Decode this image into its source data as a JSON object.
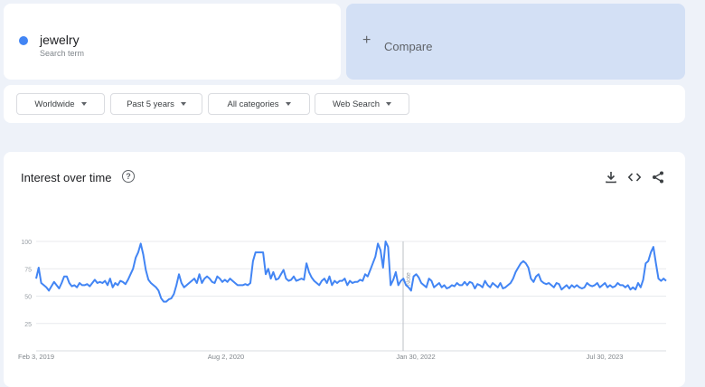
{
  "search": {
    "term": "jewelry",
    "term_subtitle": "Search term",
    "term_color": "#4285f4",
    "compare_label": "Compare",
    "compare_icon": "plus-icon"
  },
  "filters": [
    {
      "label": "Worldwide"
    },
    {
      "label": "Past 5 years"
    },
    {
      "label": "All categories"
    },
    {
      "label": "Web Search"
    }
  ],
  "chart_panel": {
    "title": "Interest over time",
    "help_icon": "help-icon",
    "tools": [
      "download-icon",
      "embed-icon",
      "share-icon"
    ]
  },
  "chart_data": {
    "type": "line",
    "ylim": [
      0,
      100
    ],
    "yticks": [
      25,
      50,
      75,
      100
    ],
    "grid": true,
    "xlabels": [
      "Feb 3, 2019",
      "Aug 2, 2020",
      "Jan 30, 2022",
      "Jul 30, 2023"
    ],
    "annotation": "Note",
    "line_color": "#4285f4",
    "series": [
      {
        "values": [
          66,
          76,
          62,
          60,
          58,
          55,
          59,
          63,
          60,
          57,
          62,
          68,
          68,
          62,
          59,
          60,
          58,
          62,
          60,
          60,
          61,
          59,
          62,
          65,
          62,
          63,
          62,
          64,
          60,
          66,
          58,
          62,
          60,
          64,
          63,
          61,
          65,
          70,
          75,
          85,
          90,
          98,
          88,
          74,
          65,
          62,
          60,
          58,
          55,
          48,
          45,
          45,
          47,
          48,
          52,
          60,
          70,
          62,
          58,
          60,
          62,
          64,
          66,
          62,
          70,
          62,
          66,
          68,
          66,
          63,
          62,
          68,
          66,
          63,
          65,
          63,
          66,
          64,
          62,
          60,
          60,
          60,
          61,
          60,
          62,
          82,
          90,
          90,
          90,
          90,
          70,
          75,
          66,
          72,
          65,
          66,
          70,
          74,
          66,
          64,
          65,
          68,
          64,
          65,
          66,
          65,
          80,
          72,
          67,
          64,
          62,
          60,
          64,
          66,
          62,
          68,
          60,
          64,
          62,
          64,
          64,
          66,
          60,
          64,
          62,
          63,
          63,
          65,
          64,
          70,
          68,
          74,
          80,
          86,
          98,
          92,
          76,
          100,
          95,
          60,
          65,
          72,
          60,
          64,
          66,
          60,
          58,
          55,
          68,
          70,
          67,
          62,
          60,
          58,
          66,
          64,
          58,
          60,
          62,
          58,
          60,
          57,
          58,
          60,
          59,
          62,
          60,
          60,
          63,
          60,
          63,
          62,
          57,
          61,
          60,
          58,
          64,
          60,
          58,
          62,
          60,
          58,
          62,
          57,
          58,
          60,
          62,
          66,
          72,
          76,
          80,
          82,
          80,
          76,
          66,
          63,
          68,
          70,
          64,
          62,
          61,
          62,
          60,
          58,
          62,
          61,
          56,
          58,
          60,
          57,
          60,
          58,
          60,
          58,
          57,
          58,
          62,
          60,
          59,
          60,
          62,
          58,
          60,
          62,
          58,
          60,
          58,
          59,
          62,
          60,
          60,
          58,
          60,
          56,
          58,
          56,
          62,
          58,
          65,
          80,
          82,
          90,
          95,
          80,
          66,
          64,
          66,
          64
        ]
      }
    ]
  }
}
